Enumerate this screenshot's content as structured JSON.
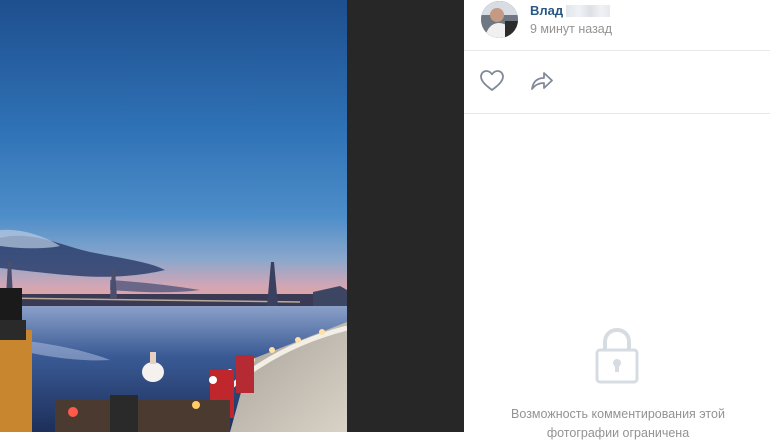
{
  "post": {
    "author_name": "Влад",
    "timestamp": "9 минут назад"
  },
  "actions": {
    "like_icon": "heart-icon",
    "share_icon": "share-arrow-icon"
  },
  "comments": {
    "lock_icon": "lock-icon",
    "restricted_text": "Возможность комментирования этой фотографии ограничена"
  },
  "colors": {
    "author_link": "#2a5885",
    "secondary_text": "#939393",
    "viewer_background": "#272727",
    "divider": "#e7e8ec"
  }
}
